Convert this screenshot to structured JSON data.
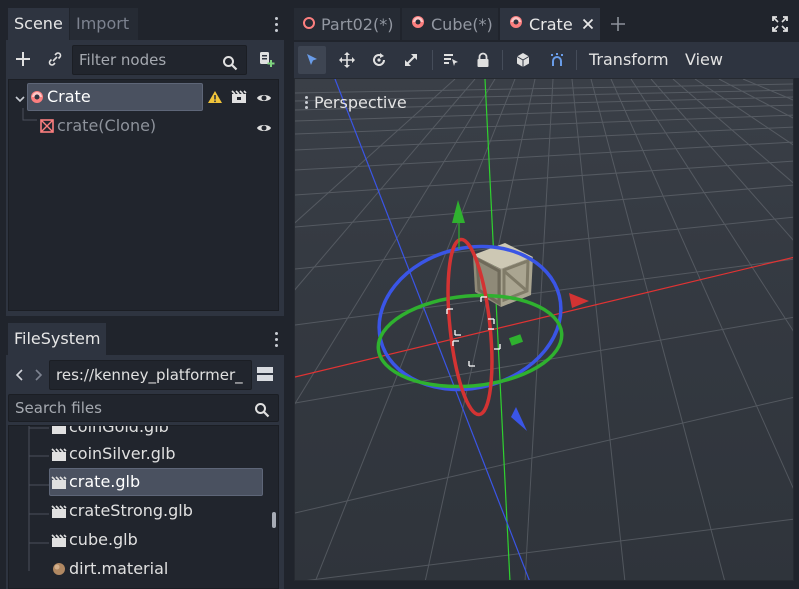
{
  "scene_dock": {
    "tabs": [
      "Scene",
      "Import"
    ],
    "filter_placeholder": "Filter nodes",
    "nodes": [
      {
        "name": "Crate",
        "icon": "mesh-instance-icon"
      },
      {
        "name": "crate(Clone)",
        "icon": "spatial-node-icon"
      }
    ]
  },
  "filesystem_dock": {
    "title": "FileSystem",
    "path": "res://kenney_platformer_",
    "search_placeholder": "Search files",
    "files": [
      {
        "name": "coinGold.glb",
        "icon": "scene-file-icon"
      },
      {
        "name": "coinSilver.glb",
        "icon": "scene-file-icon"
      },
      {
        "name": "crate.glb",
        "icon": "scene-file-icon"
      },
      {
        "name": "crateStrong.glb",
        "icon": "scene-file-icon"
      },
      {
        "name": "cube.glb",
        "icon": "scene-file-icon"
      },
      {
        "name": "dirt.material",
        "icon": "material-icon"
      }
    ]
  },
  "editor_tabs": [
    {
      "label": "Part02(*)",
      "icon": "node-circle-icon"
    },
    {
      "label": "Cube(*)",
      "icon": "mesh-instance-icon"
    },
    {
      "label": "Crate",
      "icon": "mesh-instance-icon"
    }
  ],
  "viewport_toolbar": {
    "transform_menu": "Transform",
    "view_menu": "View"
  },
  "viewport": {
    "label": "Perspective"
  },
  "colors": {
    "accent": "#699ce8",
    "x_axis": "#e03333",
    "y_axis": "#2fd12f",
    "z_axis": "#3a55e6",
    "warning": "#f0c43a"
  }
}
